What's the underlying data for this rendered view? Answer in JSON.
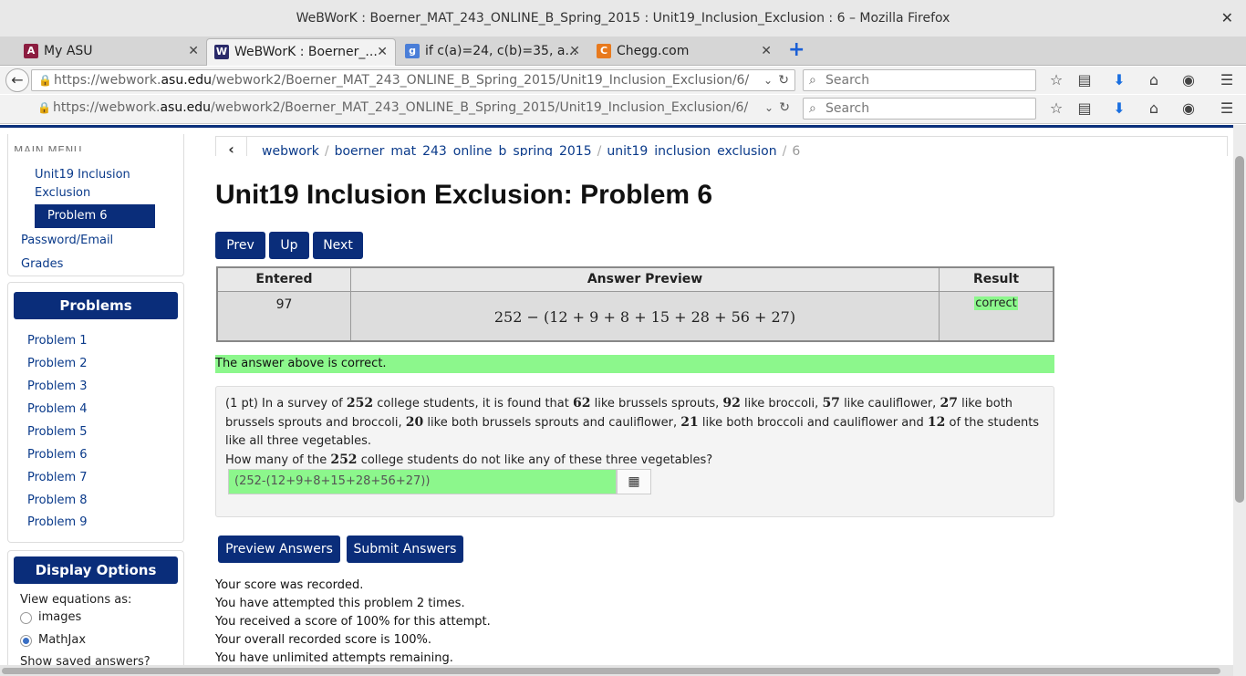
{
  "window": {
    "title": "WeBWorK : Boerner_MAT_243_ONLINE_B_Spring_2015 : Unit19_Inclusion_Exclusion : 6 – Mozilla Firefox"
  },
  "tabs": [
    {
      "label": "My ASU"
    },
    {
      "label": "WeBWorK : Boerner_..."
    },
    {
      "label": "if c(a)=24, c(b)=35, a..."
    },
    {
      "label": "Chegg.com"
    }
  ],
  "url": {
    "prefix": "https://webwork.",
    "host": "asu.edu",
    "path": "/webwork2/Boerner_MAT_243_ONLINE_B_Spring_2015/Unit19_Inclusion_Exclusion/6/"
  },
  "search": {
    "placeholder": "Search"
  },
  "sidebar": {
    "main_menu": "MAIN MENU",
    "unit_line1": "Unit19 Inclusion",
    "unit_line2": "Exclusion",
    "current_problem": "Problem 6",
    "password_email": "Password/Email",
    "grades": "Grades",
    "problems_header": "Problems",
    "problems": [
      "Problem 1",
      "Problem 2",
      "Problem 3",
      "Problem 4",
      "Problem 5",
      "Problem 6",
      "Problem 7",
      "Problem 8",
      "Problem 9"
    ],
    "display_header": "Display Options",
    "view_equations": "View equations as:",
    "opt_images": "images",
    "opt_mathjax": "MathJax",
    "show_saved": "Show saved answers?"
  },
  "breadcrumb": [
    "webwork",
    "boerner_mat_243_online_b_spring_2015",
    "unit19_inclusion_exclusion",
    "6"
  ],
  "page_title": "Unit19 Inclusion Exclusion: Problem 6",
  "nav_buttons": {
    "prev": "Prev",
    "up": "Up",
    "next": "Next"
  },
  "results": {
    "headers": {
      "entered": "Entered",
      "preview": "Answer Preview",
      "result": "Result"
    },
    "entered": "97",
    "preview": "252 − (12 + 9 + 8 + 15 + 28 + 56 + 27)",
    "result": "correct"
  },
  "correct_message": "The answer above is correct.",
  "problem": {
    "points": "(1 pt) In a survey of",
    "n1": "252",
    "t1": "college students, it is found that",
    "n2": "62",
    "t2": "like brussels sprouts,",
    "n3": "92",
    "t3": "like broccoli,",
    "n4": "57",
    "t4": "like cauliflower,",
    "n5": "27",
    "t5": "like both brussels",
    "t6": "sprouts and broccoli,",
    "n6": "20",
    "t7": "like both brussels sprouts and cauliflower,",
    "n7": "21",
    "t8": "like both broccoli and cauliflower and",
    "n8": "12",
    "t9": "of the students like all three",
    "t10": "vegetables.",
    "q_pre": "How many of the",
    "q_num": "252",
    "q_post": "college students do not like any of these three vegetables?",
    "answer_value": "(252-(12+9+8+15+28+56+27))"
  },
  "actions": {
    "preview": "Preview Answers",
    "submit": "Submit Answers"
  },
  "status_lines": [
    "Your score was recorded.",
    "You have attempted this problem 2 times.",
    "You received a score of 100% for this attempt.",
    "Your overall recorded score is 100%.",
    "You have unlimited attempts remaining."
  ],
  "colors": {
    "accent": "#0a2d7a",
    "correct": "#8cf78c"
  }
}
